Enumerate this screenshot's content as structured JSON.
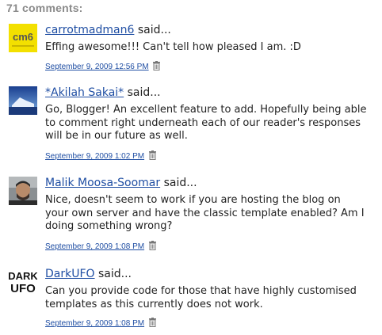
{
  "header": {
    "count_label": "71 comments:"
  },
  "comments": [
    {
      "author": "carrotmadman6",
      "said": " said...",
      "lines": [
        "Effing awesome!!! Can't tell how pleased I am. :D"
      ],
      "timestamp": "September 9, 2009 12:56 PM",
      "avatar": {
        "icon": "cm6-logo-avatar",
        "text": "cm6",
        "bg": "#f3e000"
      }
    },
    {
      "author": "*Akilah Sakai*",
      "said": " said...",
      "lines": [
        "Go, Blogger! An excellent feature to add. Hopefully being able",
        "to comment right underneath each of our reader's responses",
        "will be in our future as well."
      ],
      "timestamp": "September 9, 2009 1:02 PM",
      "avatar": {
        "icon": "iceberg-photo-avatar"
      }
    },
    {
      "author": "Malik Moosa-Soomar",
      "said": " said...",
      "lines": [
        "Nice, doesn't seem to work if you are hosting the blog on",
        "your own server and have the classic template enabled? Am I",
        "doing something wrong?"
      ],
      "timestamp": "September 9, 2009 1:08 PM",
      "avatar": {
        "icon": "person-photo-avatar"
      }
    },
    {
      "author": "DarkUFO",
      "said": " said...",
      "lines": [
        "Can you provide code for those that have highly customised",
        "templates as this currently does not work."
      ],
      "timestamp": "September 9, 2009 1:08 PM",
      "avatar": {
        "icon": "darkufo-logo-avatar",
        "text_top": "DARK",
        "text_bottom": "UFO"
      }
    }
  ],
  "colors": {
    "link": "#1f4ea3",
    "heading": "#8a8a8a",
    "text": "#222222"
  }
}
